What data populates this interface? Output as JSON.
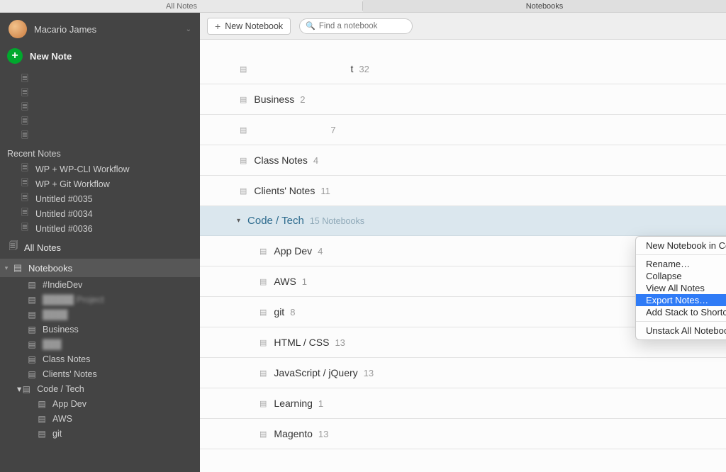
{
  "tabs": {
    "left": "All Notes",
    "right": "Notebooks"
  },
  "account": {
    "name": "Macario James"
  },
  "new_note": "New Note",
  "sidebar_placeholders": [
    "",
    "",
    "",
    "",
    ""
  ],
  "recent_header": "Recent Notes",
  "recent": [
    "WP + WP-CLI Workflow",
    "WP + Git Workflow",
    "Untitled #0035",
    "Untitled #0034",
    "Untitled #0036"
  ],
  "all_notes": "All Notes",
  "notebooks_label": "Notebooks",
  "sidebar_nbs": [
    "#IndieDev",
    "",
    "",
    "Business",
    "",
    "Class Notes",
    "Clients' Notes"
  ],
  "codetech": {
    "label": "Code / Tech",
    "children": [
      "App Dev",
      "AWS",
      "git"
    ]
  },
  "toolbar": {
    "new_nb": "New Notebook",
    "search_ph": "Find a notebook"
  },
  "main_rows_top": [
    {
      "name": "",
      "count": ""
    },
    {
      "name": "t",
      "count": "32",
      "ghost": true
    },
    {
      "name": "Business",
      "count": "2"
    },
    {
      "name": "",
      "count": "7",
      "ghost": true
    },
    {
      "name": "Class Notes",
      "count": "4"
    },
    {
      "name": "Clients' Notes",
      "count": "11"
    }
  ],
  "stack": {
    "name": "Code / Tech",
    "meta": "15 Notebooks"
  },
  "stack_children": [
    {
      "name": "App Dev",
      "count": "4"
    },
    {
      "name": "AWS",
      "count": "1"
    },
    {
      "name": "git",
      "count": "8"
    },
    {
      "name": "HTML / CSS",
      "count": "13"
    },
    {
      "name": "JavaScript / jQuery",
      "count": "13"
    },
    {
      "name": "Learning",
      "count": "1"
    },
    {
      "name": "Magento",
      "count": "13"
    }
  ],
  "ctx": [
    "New Notebook in Code / Tech",
    "Rename…",
    "Collapse",
    "View All Notes",
    "Export Notes…",
    "Add Stack to Shortcuts",
    "Unstack All Notebooks…"
  ]
}
